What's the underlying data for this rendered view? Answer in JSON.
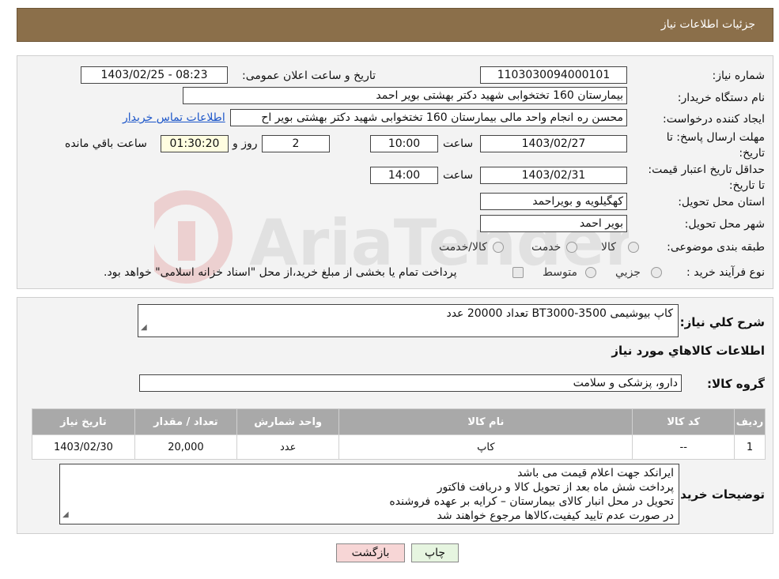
{
  "header": {
    "title": "جزئیات اطلاعات نیاز"
  },
  "need_number": {
    "label": "شماره نیاز:",
    "value": "1103030094000101"
  },
  "announce_datetime": {
    "label": "تاریخ و ساعت اعلان عمومی:",
    "value": "1403/02/25 - 08:23"
  },
  "buyer_org": {
    "label": "نام دستگاه خریدار:",
    "value": "بیمارستان 160 تختخوابی شهید دکتر بهشتی بویر احمد"
  },
  "requester": {
    "label": "ایجاد کننده درخواست:",
    "value": "محسن ره انجام واحد مالی بیمارستان 160 تختخوابی شهید دکتر بهشتی بویر اح",
    "contact_link": "اطلاعات تماس خریدار"
  },
  "deadline": {
    "label": "مهلت ارسال پاسخ: تا تاریخ:",
    "date": "1403/02/27",
    "time_label": "ساعت",
    "time": "10:00",
    "days": "2",
    "days_label": "روز و",
    "remaining": "01:30:20",
    "remaining_label": "ساعت باقي مانده"
  },
  "price_validity": {
    "label": "حداقل تاریخ اعتبار قیمت: تا تاریخ:",
    "date": "1403/02/31",
    "time_label": "ساعت",
    "time": "14:00"
  },
  "province": {
    "label": "استان محل تحویل:",
    "value": "کهگیلویه و بویراحمد"
  },
  "city": {
    "label": "شهر محل تحویل:",
    "value": "بویر احمد"
  },
  "category": {
    "label": "طبقه بندی موضوعی:",
    "options": [
      "کالا",
      "خدمت",
      "کالا/خدمت"
    ]
  },
  "purchase_type": {
    "label": "نوع فرآیند خرید :",
    "options": [
      "جزیي",
      "متوسط"
    ],
    "note": "پرداخت تمام یا بخشی از مبلغ خرید،از محل \"اسناد خزانه اسلامی\" خواهد بود."
  },
  "description": {
    "label": "شرح کلي نياز:",
    "value": "کاپ بیوشیمی BT3000-3500 تعداد 20000 عدد"
  },
  "goods_section_title": "اطلاعات کالاهاي مورد نياز",
  "goods_group": {
    "label": "گروه کالا:",
    "value": "دارو، پزشکی و سلامت"
  },
  "table": {
    "headers": [
      "رديف",
      "کد کالا",
      "نام کالا",
      "واحد شمارش",
      "تعداد / مقدار",
      "تاریخ نیاز"
    ],
    "rows": [
      [
        "1",
        "--",
        "کاپ",
        "عدد",
        "20,000",
        "1403/02/30"
      ]
    ]
  },
  "buyer_notes": {
    "label": "توضیحات خریدار:",
    "lines": [
      "ایرانکد جهت اعلام قیمت می باشد",
      "پرداخت شش ماه بعد از تحویل کالا و دریافت فاکتور",
      "تحویل در محل انبار کالای بیمارستان – کرایه بر عهده فروشنده",
      "در صورت عدم تایید کیفیت،کالاها مرجوع خواهند شد"
    ]
  },
  "buttons": {
    "print": "چاپ",
    "back": "بازگشت"
  },
  "colors": {
    "header_bg": "#8b6f4a",
    "link": "#1c56c9",
    "table_header": "#a9a9a9",
    "back_btn": "#f7d6d6",
    "print_btn": "#e6f5e0"
  }
}
